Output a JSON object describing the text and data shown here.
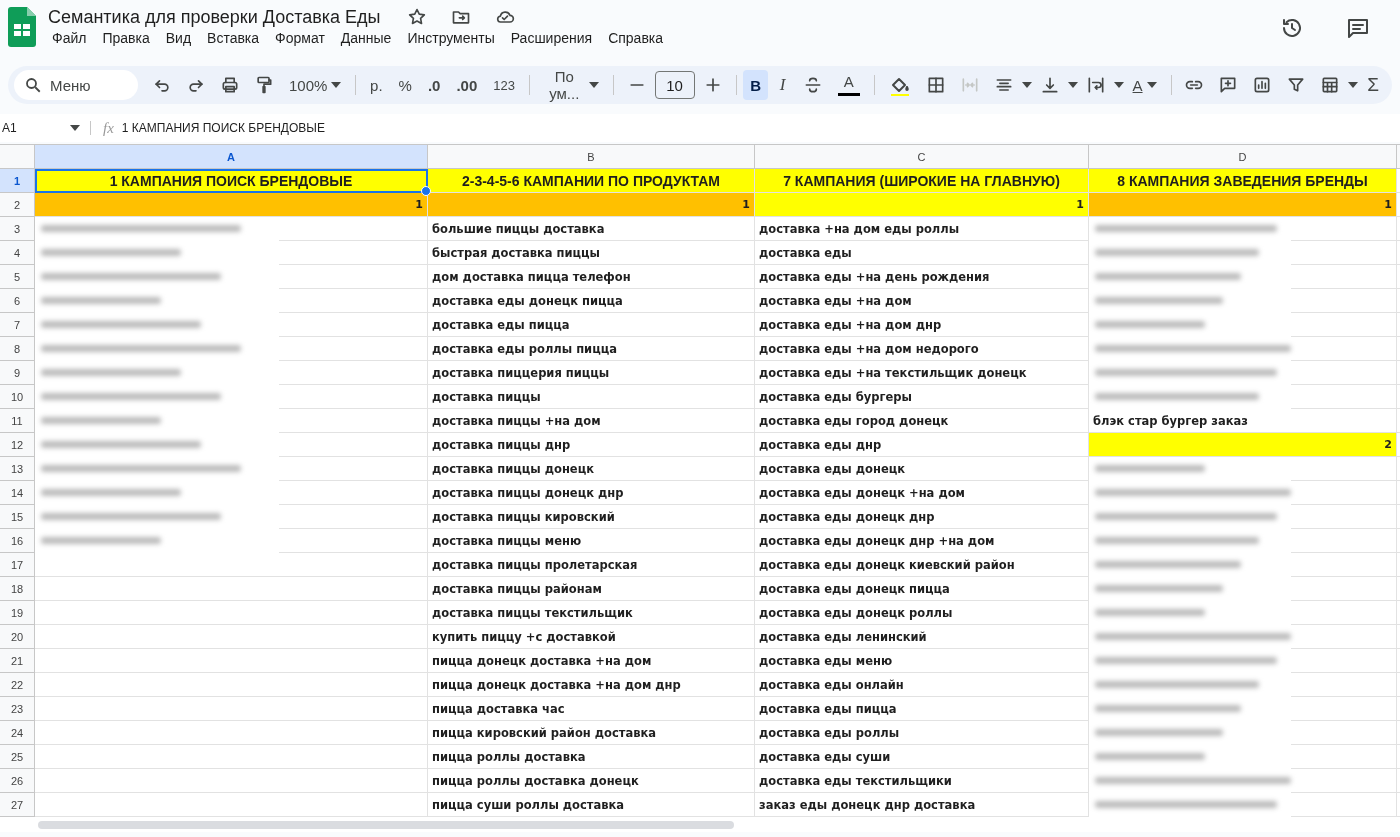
{
  "document": {
    "title": "Семантика для проверки Доставка Еды"
  },
  "menu": [
    "Файл",
    "Правка",
    "Вид",
    "Вставка",
    "Формат",
    "Данные",
    "Инструменты",
    "Расширения",
    "Справка"
  ],
  "toolbar": {
    "search": {
      "placeholder": "Меню"
    },
    "zoom": "100%",
    "currency": "р.",
    "percent": "%",
    "decrease_decimals": ".0",
    "increase_decimals": ".00",
    "number_format": "123",
    "font": "По ум...",
    "font_size": "10",
    "style_buttons": [
      {
        "label": "B",
        "selected": true
      },
      {
        "label": "I",
        "selected": false
      }
    ],
    "text_color": {
      "label": "A"
    },
    "text_rotation": {
      "label": "A"
    },
    "functions": "Σ"
  },
  "formula_bar": {
    "cell": "A1",
    "fx": "fx",
    "value": "1 КАМПАНИЯ ПОИСК БРЕНДОВЫЕ"
  },
  "table": {
    "columns": [
      {
        "label": "A",
        "selected": true
      },
      {
        "label": "B",
        "selected": false
      },
      {
        "label": "C",
        "selected": false
      },
      {
        "label": "D",
        "selected": false
      }
    ],
    "rows": [
      {
        "number": "1",
        "selected": true,
        "cells": [
          {
            "kind": "header",
            "text": "1 КАМПАНИЯ ПОИСК БРЕНДОВЫЕ",
            "color": "#ffff00",
            "selected": true
          },
          {
            "kind": "header",
            "text": "2-3-4-5-6 КАМПАНИИ ПО ПРОДУКТАМ",
            "color": "#ffff00",
            "selected": false
          },
          {
            "kind": "header",
            "text": "7 КАМПАНИЯ (ШИРОКИЕ НА ГЛАВНУЮ)",
            "color": "#ffff00",
            "selected": false
          },
          {
            "kind": "header",
            "text": "8 КАМПАНИЯ ЗАВЕДЕНИЯ БРЕНДЫ",
            "color": "#ffff00",
            "selected": false
          }
        ]
      },
      {
        "number": "2",
        "selected": false,
        "cells": [
          {
            "kind": "number",
            "text": "1",
            "color": "#ffc000"
          },
          {
            "kind": "number",
            "text": "1",
            "color": "#ffc000"
          },
          {
            "kind": "number",
            "text": "1",
            "color": "#ffff00"
          },
          {
            "kind": "number",
            "text": "1",
            "color": "#ffc000"
          }
        ]
      },
      {
        "number": "3",
        "selected": false,
        "cells": [
          {
            "kind": "redacted"
          },
          {
            "kind": "text",
            "text": "большие пиццы доставка"
          },
          {
            "kind": "text",
            "text": "доставка +на дом еды роллы"
          },
          {
            "kind": "redacted"
          }
        ]
      },
      {
        "number": "4",
        "selected": false,
        "cells": [
          {
            "kind": "redacted"
          },
          {
            "kind": "text",
            "text": "быстрая доставка пиццы"
          },
          {
            "kind": "text",
            "text": "доставка еды"
          },
          {
            "kind": "redacted"
          }
        ]
      },
      {
        "number": "5",
        "selected": false,
        "cells": [
          {
            "kind": "redacted"
          },
          {
            "kind": "text",
            "text": "дом доставка пицца телефон"
          },
          {
            "kind": "text",
            "text": "доставка еды +на день рождения"
          },
          {
            "kind": "redacted"
          }
        ]
      },
      {
        "number": "6",
        "selected": false,
        "cells": [
          {
            "kind": "redacted"
          },
          {
            "kind": "text",
            "text": "доставка еды донецк пицца"
          },
          {
            "kind": "text",
            "text": "доставка еды +на дом"
          },
          {
            "kind": "redacted"
          }
        ]
      },
      {
        "number": "7",
        "selected": false,
        "cells": [
          {
            "kind": "redacted"
          },
          {
            "kind": "text",
            "text": "доставка еды пицца"
          },
          {
            "kind": "text",
            "text": "доставка еды +на дом днр"
          },
          {
            "kind": "redacted"
          }
        ]
      },
      {
        "number": "8",
        "selected": false,
        "cells": [
          {
            "kind": "redacted"
          },
          {
            "kind": "text",
            "text": "доставка еды роллы пицца"
          },
          {
            "kind": "text",
            "text": "доставка еды +на дом недорого"
          },
          {
            "kind": "redacted"
          }
        ]
      },
      {
        "number": "9",
        "selected": false,
        "cells": [
          {
            "kind": "redacted"
          },
          {
            "kind": "text",
            "text": "доставка пиццерия пиццы"
          },
          {
            "kind": "text",
            "text": "доставка еды +на текстильщик донецк"
          },
          {
            "kind": "redacted"
          }
        ]
      },
      {
        "number": "10",
        "selected": false,
        "cells": [
          {
            "kind": "redacted"
          },
          {
            "kind": "text",
            "text": "доставка пиццы"
          },
          {
            "kind": "text",
            "text": "доставка еды бургеры"
          },
          {
            "kind": "redacted"
          }
        ]
      },
      {
        "number": "11",
        "selected": false,
        "cells": [
          {
            "kind": "redacted"
          },
          {
            "kind": "text",
            "text": "доставка пиццы +на дом"
          },
          {
            "kind": "text",
            "text": "доставка еды город донецк"
          },
          {
            "kind": "text",
            "text": "блэк стар бургер заказ"
          }
        ]
      },
      {
        "number": "12",
        "selected": false,
        "cells": [
          {
            "kind": "redacted"
          },
          {
            "kind": "text",
            "text": "доставка пиццы днр"
          },
          {
            "kind": "text",
            "text": "доставка еды днр"
          },
          {
            "kind": "number",
            "text": "2",
            "color": "#ffff00"
          }
        ]
      },
      {
        "number": "13",
        "selected": false,
        "cells": [
          {
            "kind": "redacted"
          },
          {
            "kind": "text",
            "text": "доставка пиццы донецк"
          },
          {
            "kind": "text",
            "text": "доставка еды донецк"
          },
          {
            "kind": "redacted"
          }
        ]
      },
      {
        "number": "14",
        "selected": false,
        "cells": [
          {
            "kind": "redacted"
          },
          {
            "kind": "text",
            "text": "доставка пиццы донецк днр"
          },
          {
            "kind": "text",
            "text": "доставка еды донецк +на дом"
          },
          {
            "kind": "redacted"
          }
        ]
      },
      {
        "number": "15",
        "selected": false,
        "cells": [
          {
            "kind": "redacted"
          },
          {
            "kind": "text",
            "text": "доставка пиццы кировский"
          },
          {
            "kind": "text",
            "text": "доставка еды донецк днр"
          },
          {
            "kind": "redacted"
          }
        ]
      },
      {
        "number": "16",
        "selected": false,
        "cells": [
          {
            "kind": "redacted"
          },
          {
            "kind": "text",
            "text": "доставка пиццы меню"
          },
          {
            "kind": "text",
            "text": "доставка еды донецк днр +на дом"
          },
          {
            "kind": "redacted"
          }
        ]
      },
      {
        "number": "17",
        "selected": false,
        "cells": [
          {
            "kind": "empty"
          },
          {
            "kind": "text",
            "text": "доставка пиццы пролетарская"
          },
          {
            "kind": "text",
            "text": "доставка еды донецк киевский район"
          },
          {
            "kind": "redacted"
          }
        ]
      },
      {
        "number": "18",
        "selected": false,
        "cells": [
          {
            "kind": "empty"
          },
          {
            "kind": "text",
            "text": "доставка пиццы районам"
          },
          {
            "kind": "text",
            "text": "доставка еды донецк пицца"
          },
          {
            "kind": "redacted"
          }
        ]
      },
      {
        "number": "19",
        "selected": false,
        "cells": [
          {
            "kind": "empty"
          },
          {
            "kind": "text",
            "text": "доставка пиццы текстильщик"
          },
          {
            "kind": "text",
            "text": "доставка еды донецк роллы"
          },
          {
            "kind": "redacted"
          }
        ]
      },
      {
        "number": "20",
        "selected": false,
        "cells": [
          {
            "kind": "empty"
          },
          {
            "kind": "text",
            "text": "купить пиццу +с доставкой"
          },
          {
            "kind": "text",
            "text": "доставка еды ленинский"
          },
          {
            "kind": "redacted"
          }
        ]
      },
      {
        "number": "21",
        "selected": false,
        "cells": [
          {
            "kind": "empty"
          },
          {
            "kind": "text",
            "text": "пицца донецк доставка +на дом"
          },
          {
            "kind": "text",
            "text": "доставка еды меню"
          },
          {
            "kind": "redacted"
          }
        ]
      },
      {
        "number": "22",
        "selected": false,
        "cells": [
          {
            "kind": "empty"
          },
          {
            "kind": "text",
            "text": "пицца донецк доставка +на дом днр"
          },
          {
            "kind": "text",
            "text": "доставка еды онлайн"
          },
          {
            "kind": "redacted"
          }
        ]
      },
      {
        "number": "23",
        "selected": false,
        "cells": [
          {
            "kind": "empty"
          },
          {
            "kind": "text",
            "text": "пицца доставка час"
          },
          {
            "kind": "text",
            "text": "доставка еды пицца"
          },
          {
            "kind": "redacted"
          }
        ]
      },
      {
        "number": "24",
        "selected": false,
        "cells": [
          {
            "kind": "empty"
          },
          {
            "kind": "text",
            "text": "пицца кировский район доставка"
          },
          {
            "kind": "text",
            "text": "доставка еды роллы"
          },
          {
            "kind": "redacted"
          }
        ]
      },
      {
        "number": "25",
        "selected": false,
        "cells": [
          {
            "kind": "empty"
          },
          {
            "kind": "text",
            "text": "пицца роллы доставка"
          },
          {
            "kind": "text",
            "text": "доставка еды суши"
          },
          {
            "kind": "redacted"
          }
        ]
      },
      {
        "number": "26",
        "selected": false,
        "cells": [
          {
            "kind": "empty"
          },
          {
            "kind": "text",
            "text": "пицца роллы доставка донецк"
          },
          {
            "kind": "text",
            "text": "доставка еды текстильщики"
          },
          {
            "kind": "redacted"
          }
        ]
      },
      {
        "number": "27",
        "selected": false,
        "cells": [
          {
            "kind": "empty"
          },
          {
            "kind": "text",
            "text": "пицца суши роллы доставка"
          },
          {
            "kind": "text",
            "text": "заказ еды донецк днр доставка"
          },
          {
            "kind": "redacted"
          }
        ]
      }
    ]
  }
}
